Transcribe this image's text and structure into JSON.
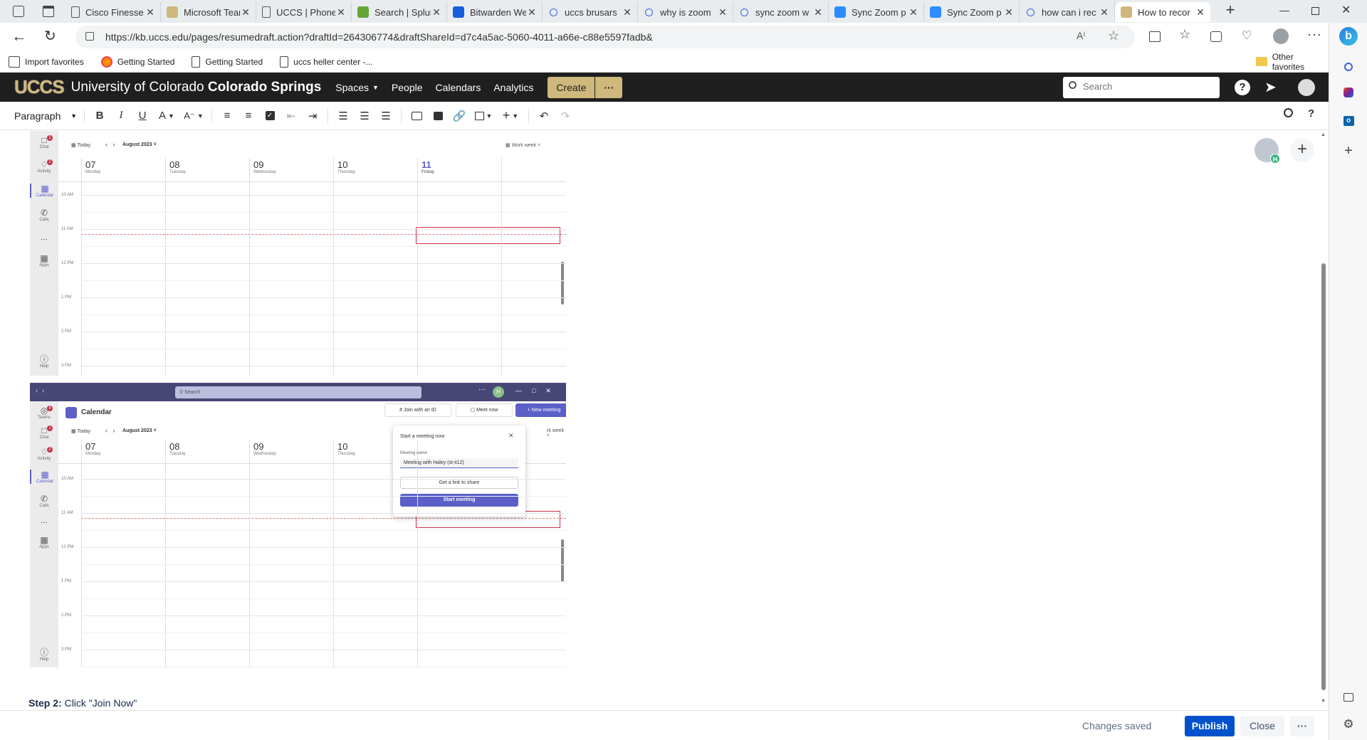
{
  "browser": {
    "tabs": [
      {
        "label": "Cisco Finesse",
        "icon": "page-icon"
      },
      {
        "label": "Microsoft Teams",
        "icon": "uccs-icon"
      },
      {
        "label": "UCCS | Phone",
        "icon": "page-icon"
      },
      {
        "label": "Search | Splunk",
        "icon": "splunk-icon"
      },
      {
        "label": "Bitwarden Web",
        "icon": "bitwarden-icon"
      },
      {
        "label": "uccs brusars",
        "icon": "search-icon"
      },
      {
        "label": "why is zoom",
        "icon": "search-icon"
      },
      {
        "label": "sync zoom w",
        "icon": "search-icon"
      },
      {
        "label": "Sync Zoom p",
        "icon": "zoom-icon"
      },
      {
        "label": "Sync Zoom p",
        "icon": "zoom-icon"
      },
      {
        "label": "how can i rec",
        "icon": "search-icon"
      },
      {
        "label": "How to recor",
        "icon": "uccs-icon",
        "active": true
      }
    ],
    "url": "https://kb.uccs.edu/pages/resumedraft.action?draftId=264306774&draftShareId=d7c4a5ac-5060-4011-a66e-c88e5597fadb&",
    "bookmarks": [
      "Import favorites",
      "Getting Started",
      "Getting Started",
      "uccs heller center -..."
    ],
    "other_favorites": "Other favorites"
  },
  "confluence": {
    "logo": "UCCS",
    "university": "University of Colorado",
    "campus": "Colorado Springs",
    "nav": [
      "Spaces",
      "People",
      "Calendars",
      "Analytics"
    ],
    "create_label": "Create",
    "more_label": "···",
    "search_placeholder": "Search"
  },
  "editor_toolbar": {
    "paragraph_label": "Paragraph"
  },
  "teams1": {
    "today": "Today",
    "month": "August 2023",
    "view": "Work week",
    "rail": [
      {
        "label": "Chat",
        "badge": "1"
      },
      {
        "label": "Activity",
        "badge": "2"
      },
      {
        "label": "Calendar"
      },
      {
        "label": "Calls"
      },
      {
        "label": "..."
      },
      {
        "label": "Apps"
      },
      {
        "label": "Help"
      }
    ],
    "days": [
      {
        "num": "07",
        "name": "Monday"
      },
      {
        "num": "08",
        "name": "Tuesday"
      },
      {
        "num": "09",
        "name": "Wednesday"
      },
      {
        "num": "10",
        "name": "Thursday"
      },
      {
        "num": "11",
        "name": "Friday"
      }
    ],
    "hours": [
      "10 AM",
      "11 AM",
      "12 PM",
      "1 PM",
      "2 PM",
      "3 PM"
    ]
  },
  "teams2": {
    "search_placeholder": "Search",
    "title": "Calendar",
    "join_id": "Join with an ID",
    "meet_now": "Meet now",
    "new_meeting": "+ New meeting",
    "today": "Today",
    "month": "August 2023",
    "view_partial": "rk week",
    "rail": [
      {
        "label": "Teams",
        "badge": "9"
      },
      {
        "label": "Chat",
        "badge": "1"
      },
      {
        "label": "Activity",
        "badge": "2"
      },
      {
        "label": "Calendar"
      },
      {
        "label": "Calls"
      },
      {
        "label": "..."
      },
      {
        "label": "Apps"
      },
      {
        "label": "Help"
      }
    ],
    "days": [
      {
        "num": "07",
        "name": "Monday"
      },
      {
        "num": "08",
        "name": "Tuesday"
      },
      {
        "num": "09",
        "name": "Wednesday"
      },
      {
        "num": "10",
        "name": "Thursday"
      }
    ],
    "hours": [
      "10 AM",
      "11 AM",
      "12 PM",
      "1 PM",
      "2 PM",
      "3 PM"
    ],
    "popup": {
      "title": "Start a meeting now",
      "name_label": "Meeting name",
      "name_value": "Meeting with Haley (st-it12)",
      "link_button": "Get a link to share",
      "start_button": "Start meeting"
    },
    "avatar_initial": "H"
  },
  "content": {
    "step_bold": "Step 2:",
    "step_text": " Click \"Join Now\""
  },
  "footer": {
    "status": "Changes saved",
    "publish": "Publish",
    "close": "Close",
    "more": "···"
  },
  "collab_avatar_initial": "H",
  "colors": {
    "teams_purple": "#5b5fc7",
    "teams_titlebar": "#464775",
    "confluence_header": "#1f1f1f",
    "create_gold": "#cfb87c",
    "publish_blue": "#0052cc"
  }
}
